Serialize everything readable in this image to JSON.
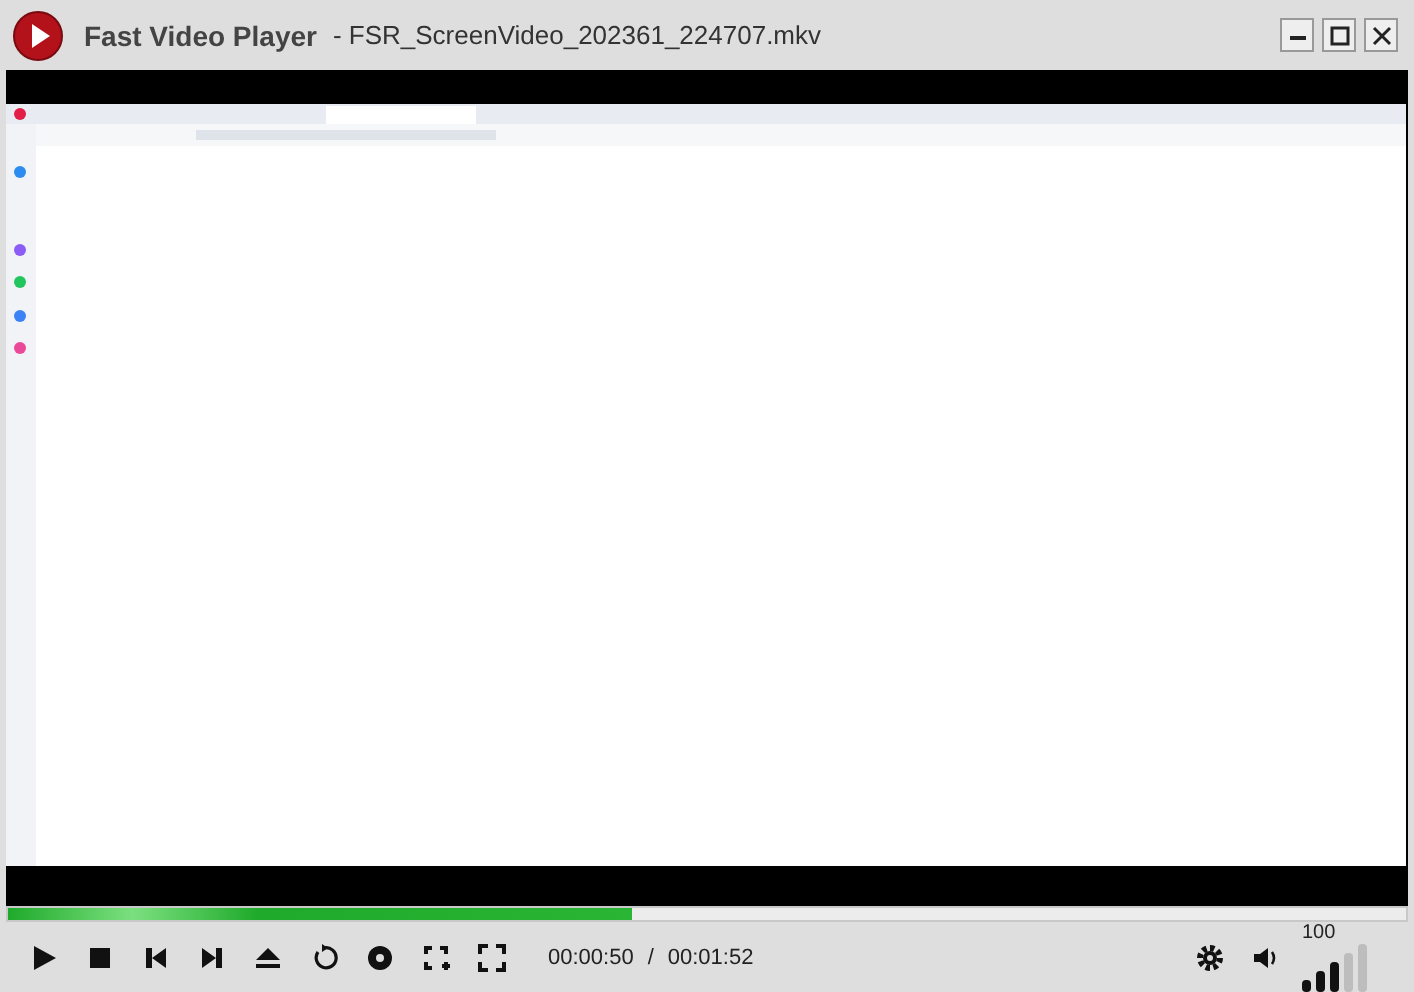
{
  "window": {
    "title": "Fast Video Player",
    "file": "- FSR_ScreenVideo_202361_224707.mkv"
  },
  "progress": {
    "level": 0.447
  },
  "time": {
    "current": "00:00:50",
    "separator": "/",
    "total": "00:01:52"
  },
  "volume": {
    "reading": "100",
    "level": 0.6
  }
}
